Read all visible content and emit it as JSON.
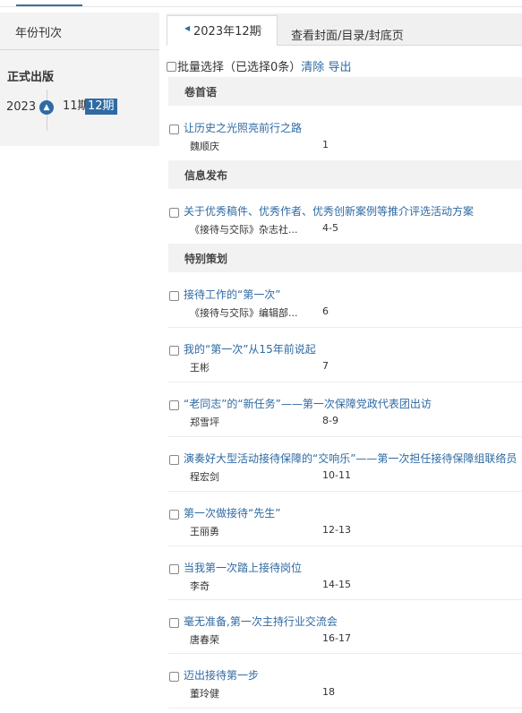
{
  "sidebar": {
    "title": "年份刊次",
    "section": "正式出版",
    "year": "2023",
    "collapse_icon": "chevron-up-icon",
    "issues": [
      {
        "label": "11期"
      },
      {
        "label": "12期"
      }
    ]
  },
  "tabs": {
    "active": "2023年12期",
    "other": "查看封面/目录/封底页"
  },
  "toolbar": {
    "batch_select": "批量选择",
    "selected_count": "（已选择0条）",
    "clear": "清除",
    "export": "导出"
  },
  "sections": [
    {
      "name": "卷首语"
    },
    {
      "name": "信息发布"
    },
    {
      "name": "特别策划"
    }
  ],
  "articles": [
    {
      "title": "让历史之光照亮前行之路",
      "author": "魏顺庆",
      "pages": "1"
    },
    {
      "title": "关于优秀稿件、优秀作者、优秀创新案例等推介评选活动方案",
      "author": "《接待与交际》杂志社...",
      "pages": "4-5"
    },
    {
      "title": "接待工作的“第一次”",
      "author": "《接待与交际》编辑部...",
      "pages": "6"
    },
    {
      "title": "我的“第一次”从15年前说起",
      "author": "王彬",
      "pages": "7"
    },
    {
      "title": "“老同志”的“新任务”——第一次保障党政代表团出访",
      "author": "郑雪坪",
      "pages": "8-9"
    },
    {
      "title": "演奏好大型活动接待保障的“交响乐”——第一次担任接待保障组联络员",
      "author": "程宏剑",
      "pages": "10-11"
    },
    {
      "title": "第一次做接待“先生”",
      "author": "王丽勇",
      "pages": "12-13"
    },
    {
      "title": "当我第一次踏上接待岗位",
      "author": "李奇",
      "pages": "14-15"
    },
    {
      "title": "毫无准备,第一次主持行业交流会",
      "author": "唐春荣",
      "pages": "16-17"
    },
    {
      "title": "迈出接待第一步",
      "author": "董玲健",
      "pages": "18"
    }
  ]
}
